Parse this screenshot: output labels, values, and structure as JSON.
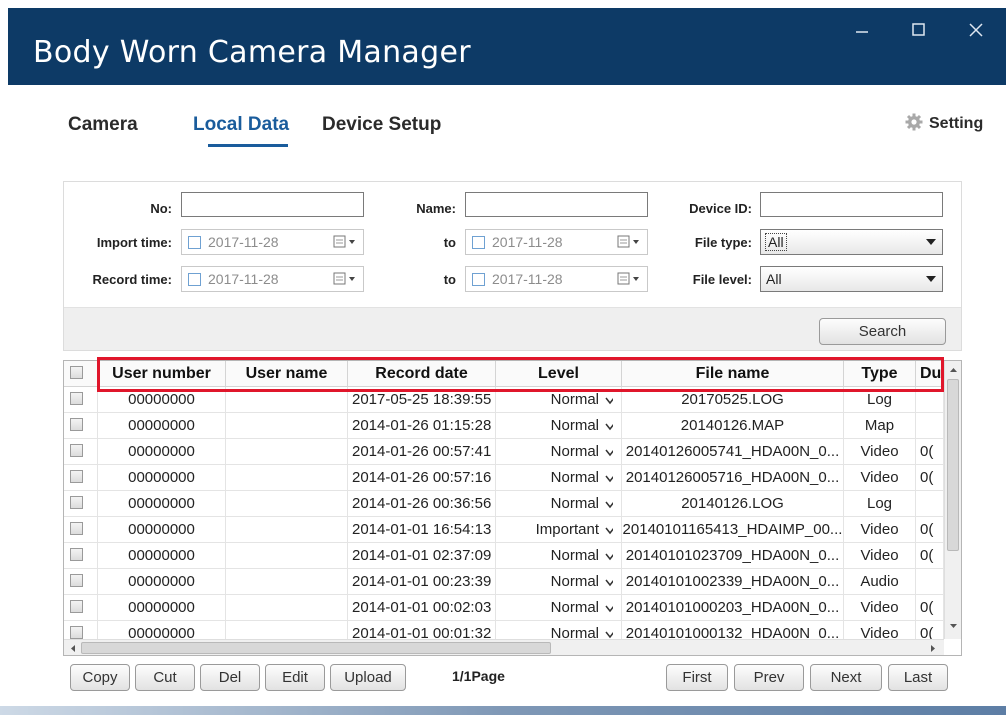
{
  "app": {
    "title": "Body Worn Camera Manager"
  },
  "tabs": [
    {
      "label": "Camera"
    },
    {
      "label": "Local Data"
    },
    {
      "label": "Device Setup"
    }
  ],
  "setting": {
    "label": "Setting"
  },
  "filters": {
    "no_label": "No:",
    "name_label": "Name:",
    "device_id_label": "Device ID:",
    "import_time_label": "Import time:",
    "record_time_label": "Record time:",
    "to_label": "to",
    "import_from": "2017-11-28",
    "import_to": "2017-11-28",
    "record_from": "2017-11-28",
    "record_to": "2017-11-28",
    "file_type_label": "File type:",
    "file_type_value": "All",
    "file_level_label": "File level:",
    "file_level_value": "All",
    "search_button": "Search"
  },
  "table": {
    "columns": [
      "User number",
      "User name",
      "Record date",
      "Level",
      "File name",
      "Type",
      "Du"
    ],
    "rows": [
      {
        "user_number": "00000000",
        "user_name": "",
        "record_date": "2017-05-25 18:39:55",
        "level": "Normal",
        "file_name": "20170525.LOG",
        "type": "Log",
        "du": ""
      },
      {
        "user_number": "00000000",
        "user_name": "",
        "record_date": "2014-01-26 01:15:28",
        "level": "Normal",
        "file_name": "20140126.MAP",
        "type": "Map",
        "du": ""
      },
      {
        "user_number": "00000000",
        "user_name": "",
        "record_date": "2014-01-26 00:57:41",
        "level": "Normal",
        "file_name": "20140126005741_HDA00N_0...",
        "type": "Video",
        "du": "0("
      },
      {
        "user_number": "00000000",
        "user_name": "",
        "record_date": "2014-01-26 00:57:16",
        "level": "Normal",
        "file_name": "20140126005716_HDA00N_0...",
        "type": "Video",
        "du": "0("
      },
      {
        "user_number": "00000000",
        "user_name": "",
        "record_date": "2014-01-26 00:36:56",
        "level": "Normal",
        "file_name": "20140126.LOG",
        "type": "Log",
        "du": ""
      },
      {
        "user_number": "00000000",
        "user_name": "",
        "record_date": "2014-01-01 16:54:13",
        "level": "Important",
        "file_name": "20140101165413_HDAIMP_00...",
        "type": "Video",
        "du": "0("
      },
      {
        "user_number": "00000000",
        "user_name": "",
        "record_date": "2014-01-01 02:37:09",
        "level": "Normal",
        "file_name": "20140101023709_HDA00N_0...",
        "type": "Video",
        "du": "0("
      },
      {
        "user_number": "00000000",
        "user_name": "",
        "record_date": "2014-01-01 00:23:39",
        "level": "Normal",
        "file_name": "20140101002339_HDA00N_0...",
        "type": "Audio",
        "du": ""
      },
      {
        "user_number": "00000000",
        "user_name": "",
        "record_date": "2014-01-01 00:02:03",
        "level": "Normal",
        "file_name": "20140101000203_HDA00N_0...",
        "type": "Video",
        "du": "0("
      },
      {
        "user_number": "00000000",
        "user_name": "",
        "record_date": "2014-01-01 00:01:32",
        "level": "Normal",
        "file_name": "20140101000132_HDA00N_0...",
        "type": "Video",
        "du": "0("
      }
    ]
  },
  "actions": {
    "copy": "Copy",
    "cut": "Cut",
    "del": "Del",
    "edit": "Edit",
    "upload": "Upload"
  },
  "pagination": {
    "page_info": "1/1Page",
    "first": "First",
    "prev": "Prev",
    "next": "Next",
    "last": "Last"
  },
  "colors": {
    "titlebar": "#0d3a66",
    "active_tab": "#1a5c9c",
    "highlight_box": "#e0162b"
  }
}
